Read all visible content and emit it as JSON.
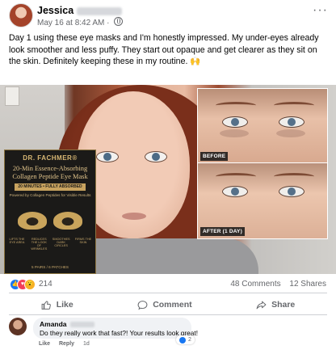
{
  "post": {
    "author": "Jessica",
    "date": "May 16 at 8:42 AM",
    "separator": "·",
    "more": "···",
    "caption": "Day 1 using these eye masks and I'm honestly impressed. My under-eyes already look smoother and less puffy. They start out opaque and get clearer as they sit on the skin. Definitely keeping these in my routine. 🙌"
  },
  "image": {
    "box": {
      "brand": "DR. FACHMER®",
      "title_line1": "20-Min Essence-Absorbing",
      "title_line2": "Collagen Peptide Eye Mask",
      "band": "20 MINUTES • FULLY ABSORBED",
      "subline": "Powered by Collagen Peptides for Visible Results",
      "features": [
        "LIFTS THE EYE AREA",
        "REDUCES THE LOOK OF WRINKLES",
        "SMOOTHES DARK CIRCLES",
        "FIRMS THE SKIN"
      ],
      "footer": "5 PAIRS / 6 PATCHES"
    },
    "before_label": "BEFORE",
    "after_label": "AFTER (1 DAY)"
  },
  "reactions": {
    "count": "214",
    "comments": "48 Comments",
    "shares": "12 Shares",
    "colors": {
      "like": "#1877f2",
      "love": "#f33e58",
      "wow": "#f7b125"
    }
  },
  "actions": {
    "like": "Like",
    "comment": "Comment",
    "share": "Share"
  },
  "comment": {
    "author": "Amanda",
    "text": "Do they really work that fast?! Your results look great!",
    "reaction_count": "2",
    "like": "Like",
    "reply": "Reply",
    "time": "1d"
  }
}
